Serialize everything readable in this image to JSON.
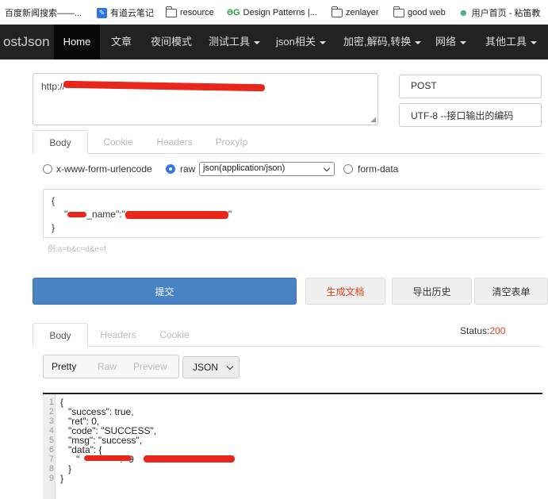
{
  "bookmarks": [
    {
      "label": "百度新闻搜索——...",
      "icon": "none"
    },
    {
      "label": "有道云笔记",
      "icon": "youdao-icon"
    },
    {
      "label": "resource",
      "icon": "folder-icon"
    },
    {
      "label": "Design Patterns |...",
      "icon": "dg-icon"
    },
    {
      "label": "zenlayer",
      "icon": "folder-icon"
    },
    {
      "label": "good web",
      "icon": "folder-icon"
    },
    {
      "label": "用户首页 - 粘笛教",
      "icon": "user-icon"
    }
  ],
  "nav": {
    "brand": "ostJson",
    "items": [
      "Home",
      "文章",
      "夜间模式",
      "测试工具",
      "json相关",
      "加密,解码,转换",
      "网络",
      "其他工具"
    ]
  },
  "request": {
    "url": "http://",
    "method": "POST",
    "encoding": "UTF-8 --接口输出的编码",
    "tabs": [
      "Body",
      "Cookie",
      "Headers",
      "ProxyIp"
    ],
    "body_types": [
      "x-www-form-urlencode",
      "raw",
      "form-data"
    ],
    "content_type": "json(application/json)",
    "body_open": "{",
    "body_key_suffix": "_name",
    "body_close": "}",
    "hint": "例:a=b&c=d&e=f"
  },
  "actions": {
    "submit": "提交",
    "generate": "生成文档",
    "export": "导出历史",
    "clear": "清空表单"
  },
  "response": {
    "tabs": [
      "Body",
      "Headers",
      "Cookie"
    ],
    "status_label": "Status:",
    "status_code": "200",
    "views": [
      "Pretty",
      "Raw",
      "Preview"
    ],
    "format": "JSON",
    "lines": [
      {
        "n": "1",
        "t": "{"
      },
      {
        "n": "2",
        "t": "   \"success\": true,"
      },
      {
        "n": "3",
        "t": "   \"ret\": 0,"
      },
      {
        "n": "4",
        "t": "   \"code\": \"SUCCESS\","
      },
      {
        "n": "5",
        "t": "   \"msg\": \"success\","
      },
      {
        "n": "6",
        "t": "   \"data\": {"
      },
      {
        "n": "7",
        "t": "      \"              \": \"9                        9\""
      },
      {
        "n": "8",
        "t": "   }"
      },
      {
        "n": "9",
        "t": "}"
      }
    ]
  },
  "colors": {
    "accent": "#4a83c3",
    "status": "#e8401a",
    "redaction": "#e8261a",
    "navbar": "#222222"
  }
}
